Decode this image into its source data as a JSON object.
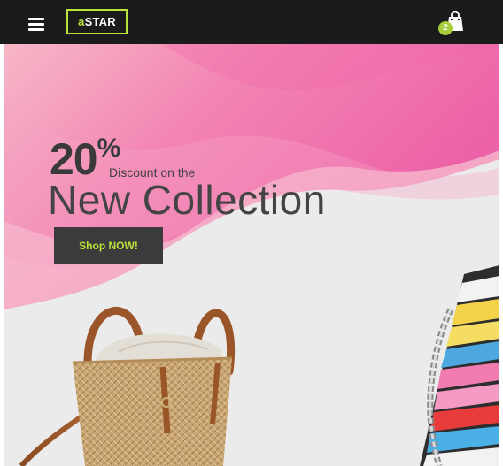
{
  "header": {
    "logo_prefix": "a",
    "logo_text": "STAR",
    "cart_count": "2"
  },
  "hero": {
    "discount_value": "20",
    "discount_sign": "%",
    "discount_text": "Discount on the",
    "title": "New Collection",
    "cta_label": "Shop NOW!"
  },
  "colors": {
    "accent": "#b9e23b",
    "header_bg": "#1b1b1b",
    "button_bg": "#3b3b3b",
    "hero_pink": "#ef5fa4"
  },
  "icons": [
    "menu-icon",
    "shopping-bag-icon"
  ]
}
